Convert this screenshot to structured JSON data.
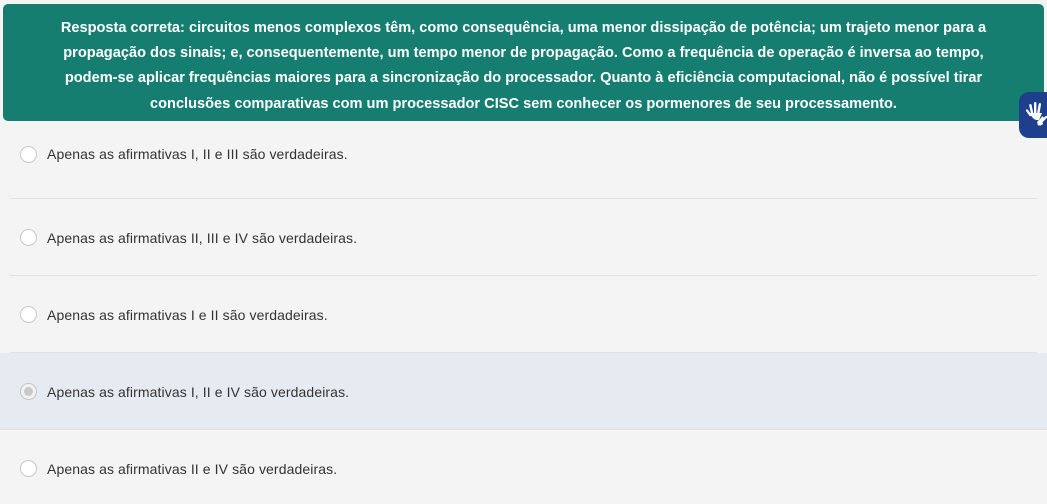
{
  "feedback": {
    "text": "Resposta correta: circuitos menos complexos têm, como consequência, uma menor dissipação de potência; um trajeto menor para a propagação dos sinais; e, consequentemente, um tempo menor de propagação. Como a frequência de operação é inversa ao tempo, podem-se aplicar frequências maiores para a sincronização do processador. Quanto à eficiência computacional, não é possível tirar conclusões comparativas com um processador CISC sem conhecer os pormenores de seu processamento.",
    "background_color": "#167e71"
  },
  "accessibility_button": {
    "icon": "sign-language-hands-icon",
    "color": "#1d3f8c"
  },
  "options": [
    {
      "label": "Apenas as afirmativas I, II e III são verdadeiras.",
      "selected": false
    },
    {
      "label": "Apenas as afirmativas II, III e IV são verdadeiras.",
      "selected": false
    },
    {
      "label": "Apenas as afirmativas I e II são verdadeiras.",
      "selected": false
    },
    {
      "label": "Apenas as afirmativas I, II e IV são verdadeiras.",
      "selected": true
    },
    {
      "label": "Apenas as afirmativas II e IV são verdadeiras.",
      "selected": false
    }
  ]
}
